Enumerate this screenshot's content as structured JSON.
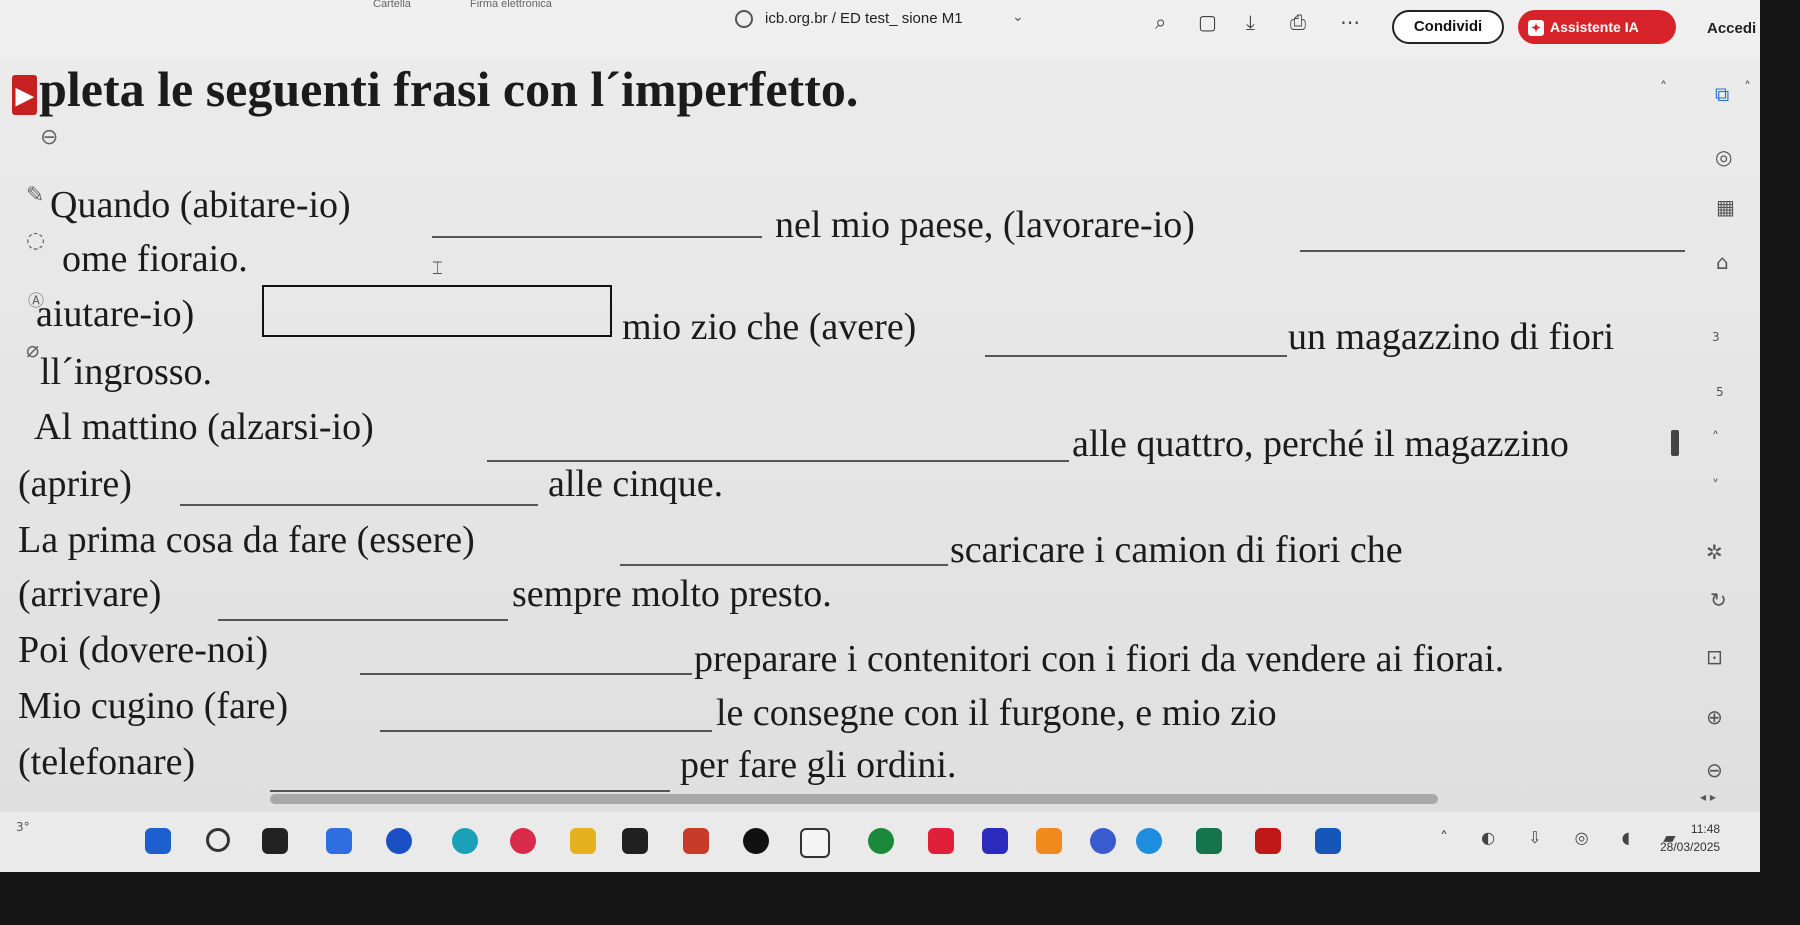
{
  "browser": {
    "crumb_file": "Cartella",
    "crumb_sign": "Firma elettronica",
    "doc_title": "icb.org.br / ED test_ sione M1",
    "share_label": "Condividi",
    "ai_label": "Assistente IA",
    "login_label": "Accedi"
  },
  "document": {
    "heading": "pleta le seguenti frasi con l´imperfetto.",
    "heading_highlight": "▸",
    "lines": [
      {
        "segments": [
          "Quando (abitare-io)",
          "nel mio paese, (lavorare-io)"
        ]
      },
      {
        "segments": [
          "ome fioraio."
        ]
      },
      {
        "segments": [
          "aiutare-io)",
          "mio zio che (avere)",
          "un magazzino di fiori"
        ]
      },
      {
        "segments": [
          "ll´ingrosso."
        ]
      },
      {
        "segments": [
          "Al mattino (alzarsi-io)",
          "alle quattro, perché il magazzino"
        ]
      },
      {
        "segments": [
          "(aprire)",
          "alle cinque."
        ]
      },
      {
        "segments": [
          "La prima cosa da fare (essere)",
          "scaricare i camion di fiori che"
        ]
      },
      {
        "segments": [
          "(arrivare)",
          "sempre molto presto."
        ]
      },
      {
        "segments": [
          "Poi (dovere-noi)",
          "preparare i contenitori con i fiori da vendere ai fiorai."
        ]
      },
      {
        "segments": [
          "Mio cugino (fare)",
          "le consegne con il furgone, e mio zio"
        ]
      },
      {
        "segments": [
          "(telefonare)",
          "per fare gli ordini."
        ]
      }
    ]
  },
  "side_toolbar": {
    "page_numbers": [
      "3",
      "5"
    ]
  },
  "taskbar": {
    "time": "11:48",
    "date": "28/03/2025",
    "temp": "3°"
  },
  "colors": {
    "accent_red": "#d8222a",
    "page_bg": "#e8e8e8",
    "taskbar_bg": "#eaeaea"
  }
}
